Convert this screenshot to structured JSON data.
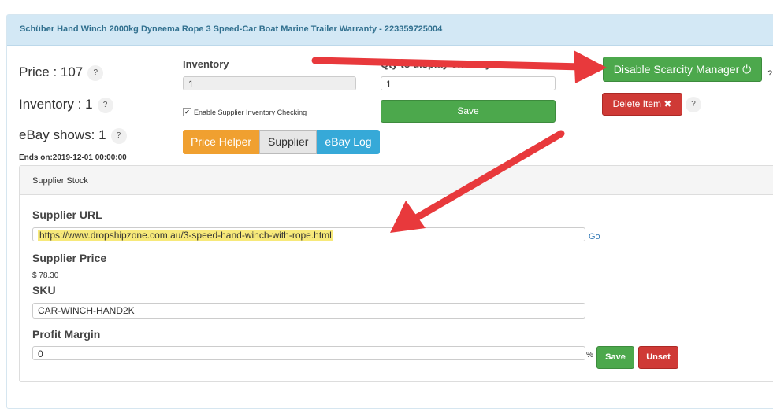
{
  "title": "Schüber Hand Winch 2000kg Dyneema Rope 3 Speed-Car Boat Marine Trailer Warranty - 223359725004",
  "summary": {
    "price": "Price : 107",
    "inventory": "Inventory : 1",
    "ebay_shows": "eBay shows: 1",
    "ends_on": "Ends on:2019-12-01 00:00:00",
    "help": "?"
  },
  "inventory": {
    "label": "Inventory",
    "value": "1",
    "checkbox_label": "Enable Supplier Inventory Checking",
    "checked": true
  },
  "qty": {
    "label": "Qty to display on eBay",
    "value": "1",
    "save": "Save"
  },
  "tabs": {
    "price_helper": "Price Helper",
    "supplier": "Supplier",
    "ebay_log": "eBay Log"
  },
  "actions": {
    "scarcity": "Disable Scarcity Manager",
    "delete": "Delete Item",
    "help": "?"
  },
  "stock": {
    "heading": "Supplier Stock",
    "url_label": "Supplier URL",
    "url": "https://www.dropshipzone.com.au/3-speed-hand-winch-with-rope.html",
    "go": "Go",
    "price_label": "Supplier Price",
    "price": "$ 78.30",
    "sku_label": "SKU",
    "sku": "CAR-WINCH-HAND2K",
    "margin_label": "Profit Margin",
    "margin": "0",
    "percent": "%",
    "save": "Save",
    "unset": "Unset"
  },
  "colors": {
    "arrow": "#e8393c",
    "highlight": "#f7e97a"
  }
}
